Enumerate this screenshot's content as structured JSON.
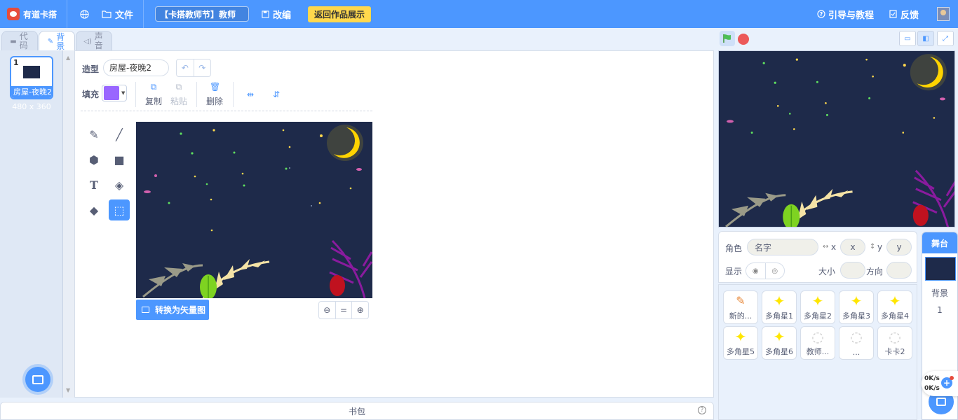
{
  "menubar": {
    "logo_text": "有道卡搭",
    "file_label": "文件",
    "project_title": "【卡搭教师节】教师",
    "remix_label": "改编",
    "return_label": "返回作品展示",
    "guide_label": "引导与教程",
    "feedback_label": "反馈"
  },
  "tabs": [
    {
      "label": "代码"
    },
    {
      "label": "背景"
    },
    {
      "label": "声音"
    }
  ],
  "costumes": {
    "items": [
      {
        "index": "1",
        "name": "房屋-夜晚2",
        "size": "480 x 360"
      }
    ]
  },
  "editor": {
    "costume_label": "造型",
    "costume_name": "房屋-夜晚2",
    "fill_label": "填充",
    "fill_color": "#9966ff",
    "copy_label": "复制",
    "paste_label": "粘贴",
    "delete_label": "删除",
    "convert_label": "转换为矢量图",
    "zoom_reset": "="
  },
  "backpack": {
    "label": "书包"
  },
  "sprite_info": {
    "sprite_label": "角色",
    "name_placeholder": "名字",
    "x_label": "x",
    "x_placeholder": "x",
    "y_label": "y",
    "y_placeholder": "y",
    "show_label": "显示",
    "size_label": "大小",
    "direction_label": "方向"
  },
  "sprites": [
    {
      "name": "新的..."
    },
    {
      "name": "多角星1"
    },
    {
      "name": "多角星2"
    },
    {
      "name": "多角星3"
    },
    {
      "name": "多角星4"
    },
    {
      "name": "多角星5"
    },
    {
      "name": "多角星6"
    },
    {
      "name": "教师..."
    },
    {
      "name": "..."
    },
    {
      "name": "卡卡2"
    }
  ],
  "stage_panel": {
    "header": "舞台",
    "backdrop_label": "背景",
    "backdrop_count": "1"
  },
  "network": {
    "up": "0K/s",
    "down": "0K/s"
  },
  "colors": {
    "accent": "#4c97ff",
    "highlight": "#ffd84d",
    "canvas_bg": "#1e2a4a",
    "moon": "#ffd400"
  }
}
